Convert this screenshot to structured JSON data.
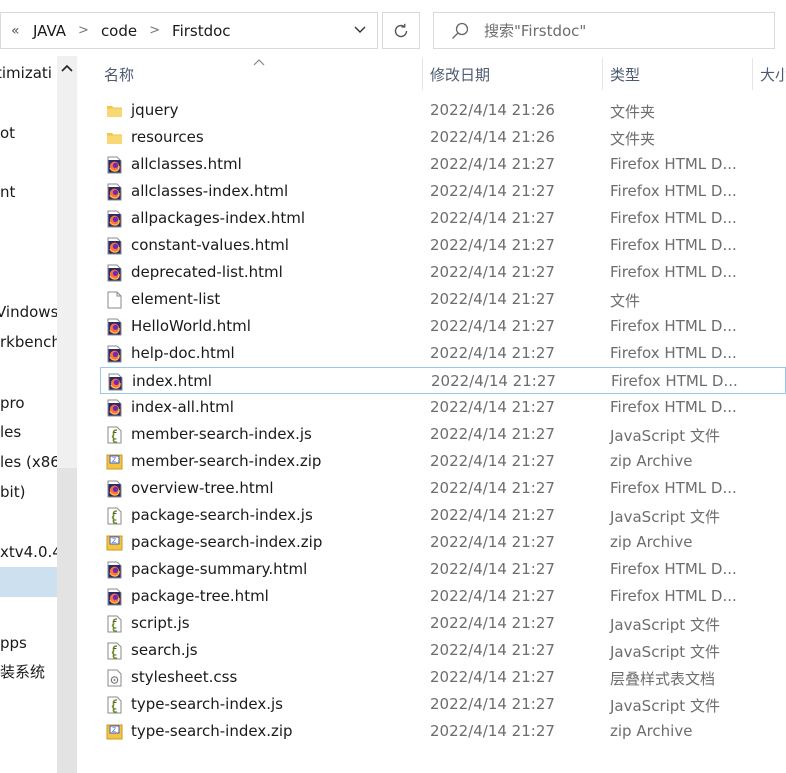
{
  "address": {
    "breadcrumbs": [
      "JAVA",
      "code",
      "Firstdoc"
    ],
    "prefix": "«"
  },
  "search": {
    "placeholder": "搜索\"Firstdoc\""
  },
  "nav": {
    "items": [
      "timizati",
      "ot",
      "nt",
      "Vindows",
      "rkbench",
      "pro",
      "les",
      "les (x86",
      "bit)",
      "xtv4.0.4",
      "pps",
      "装系统"
    ]
  },
  "columns": {
    "name": "名称",
    "date": "修改日期",
    "type": "类型",
    "size": "大小"
  },
  "files": [
    {
      "name": "jquery",
      "date": "2022/4/14 21:26",
      "type": "文件夹",
      "icon": "folder-icon"
    },
    {
      "name": "resources",
      "date": "2022/4/14 21:26",
      "type": "文件夹",
      "icon": "folder-icon"
    },
    {
      "name": "allclasses.html",
      "date": "2022/4/14 21:27",
      "type": "Firefox HTML D...",
      "icon": "firefox-icon"
    },
    {
      "name": "allclasses-index.html",
      "date": "2022/4/14 21:27",
      "type": "Firefox HTML D...",
      "icon": "firefox-icon"
    },
    {
      "name": "allpackages-index.html",
      "date": "2022/4/14 21:27",
      "type": "Firefox HTML D...",
      "icon": "firefox-icon"
    },
    {
      "name": "constant-values.html",
      "date": "2022/4/14 21:27",
      "type": "Firefox HTML D...",
      "icon": "firefox-icon"
    },
    {
      "name": "deprecated-list.html",
      "date": "2022/4/14 21:27",
      "type": "Firefox HTML D...",
      "icon": "firefox-icon"
    },
    {
      "name": "element-list",
      "date": "2022/4/14 21:27",
      "type": "文件",
      "icon": "blank-file-icon"
    },
    {
      "name": "HelloWorld.html",
      "date": "2022/4/14 21:27",
      "type": "Firefox HTML D...",
      "icon": "firefox-icon"
    },
    {
      "name": "help-doc.html",
      "date": "2022/4/14 21:27",
      "type": "Firefox HTML D...",
      "icon": "firefox-icon"
    },
    {
      "name": "index.html",
      "date": "2022/4/14 21:27",
      "type": "Firefox HTML D...",
      "icon": "firefox-icon"
    },
    {
      "name": "index-all.html",
      "date": "2022/4/14 21:27",
      "type": "Firefox HTML D...",
      "icon": "firefox-icon"
    },
    {
      "name": "member-search-index.js",
      "date": "2022/4/14 21:27",
      "type": "JavaScript 文件",
      "icon": "script-icon"
    },
    {
      "name": "member-search-index.zip",
      "date": "2022/4/14 21:27",
      "type": "zip Archive",
      "icon": "zip-icon"
    },
    {
      "name": "overview-tree.html",
      "date": "2022/4/14 21:27",
      "type": "Firefox HTML D...",
      "icon": "firefox-icon"
    },
    {
      "name": "package-search-index.js",
      "date": "2022/4/14 21:27",
      "type": "JavaScript 文件",
      "icon": "script-icon"
    },
    {
      "name": "package-search-index.zip",
      "date": "2022/4/14 21:27",
      "type": "zip Archive",
      "icon": "zip-icon"
    },
    {
      "name": "package-summary.html",
      "date": "2022/4/14 21:27",
      "type": "Firefox HTML D...",
      "icon": "firefox-icon"
    },
    {
      "name": "package-tree.html",
      "date": "2022/4/14 21:27",
      "type": "Firefox HTML D...",
      "icon": "firefox-icon"
    },
    {
      "name": "script.js",
      "date": "2022/4/14 21:27",
      "type": "JavaScript 文件",
      "icon": "script-icon"
    },
    {
      "name": "search.js",
      "date": "2022/4/14 21:27",
      "type": "JavaScript 文件",
      "icon": "script-icon"
    },
    {
      "name": "stylesheet.css",
      "date": "2022/4/14 21:27",
      "type": "层叠样式表文档",
      "icon": "css-icon"
    },
    {
      "name": "type-search-index.js",
      "date": "2022/4/14 21:27",
      "type": "JavaScript 文件",
      "icon": "script-icon"
    },
    {
      "name": "type-search-index.zip",
      "date": "2022/4/14 21:27",
      "type": "zip Archive",
      "icon": "zip-icon"
    }
  ],
  "selected_file": "index.html",
  "colors": {
    "selection_border": "#99c9ef",
    "nav_selected": "#cce0f0",
    "header_text": "#4c5b72",
    "folder": "#f4c542"
  }
}
